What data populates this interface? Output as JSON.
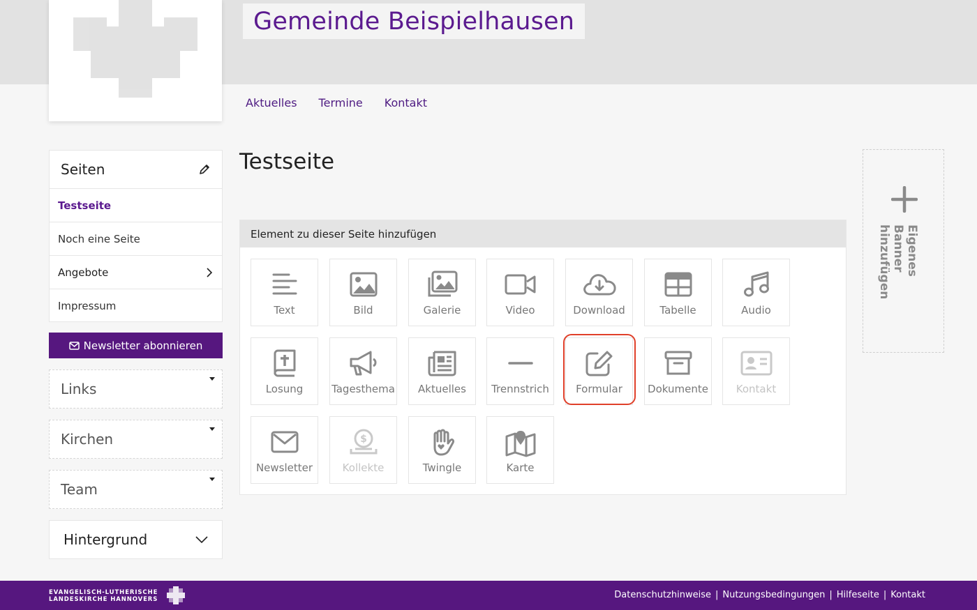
{
  "site": {
    "title": "Gemeinde Beispielhausen"
  },
  "nav": [
    "Aktuelles",
    "Termine",
    "Kontakt"
  ],
  "sidebar": {
    "pages_title": "Seiten",
    "pages": [
      {
        "label": "Testseite",
        "active": true
      },
      {
        "label": "Noch eine Seite"
      },
      {
        "label": "Angebote",
        "has_children": true
      },
      {
        "label": "Impressum"
      }
    ],
    "newsletter_button": "Newsletter abonnieren",
    "widgets": [
      "Links",
      "Kirchen",
      "Team"
    ],
    "background_label": "Hintergrund"
  },
  "main": {
    "page_title": "Testseite",
    "panel_title": "Element zu dieser Seite hinzufügen",
    "elements": [
      {
        "label": "Text",
        "icon": "text-icon"
      },
      {
        "label": "Bild",
        "icon": "image-icon"
      },
      {
        "label": "Galerie",
        "icon": "gallery-icon"
      },
      {
        "label": "Video",
        "icon": "video-icon"
      },
      {
        "label": "Download",
        "icon": "cloud-download-icon"
      },
      {
        "label": "Tabelle",
        "icon": "table-icon"
      },
      {
        "label": "Audio",
        "icon": "music-icon"
      },
      {
        "label": "Losung",
        "icon": "bible-icon"
      },
      {
        "label": "Tagesthema",
        "icon": "megaphone-icon"
      },
      {
        "label": "Aktuelles",
        "icon": "newspaper-icon"
      },
      {
        "label": "Trennstrich",
        "icon": "divider-icon"
      },
      {
        "label": "Formular",
        "icon": "edit-form-icon",
        "highlighted": true
      },
      {
        "label": "Dokumente",
        "icon": "archive-icon"
      },
      {
        "label": "Kontakt",
        "icon": "contact-card-icon",
        "disabled": true
      },
      {
        "label": "Newsletter",
        "icon": "envelope-icon"
      },
      {
        "label": "Kollekte",
        "icon": "donation-icon",
        "disabled": true
      },
      {
        "label": "Twingle",
        "icon": "hand-heart-icon"
      },
      {
        "label": "Karte",
        "icon": "map-icon"
      }
    ]
  },
  "banner": {
    "add_label": "Eigenes Banner hinzufügen"
  },
  "footer": {
    "brand_line1": "EVANGELISCH-LUTHERISCHE",
    "brand_line2": "LANDESKIRCHE HANNOVERS",
    "links": [
      "Datenschutzhinweise",
      "Nutzungsbedingungen",
      "Hilfeseite",
      "Kontakt"
    ]
  },
  "colors": {
    "brand": "#56177f",
    "accent_text": "#5b1a8f",
    "highlight": "#e0402a"
  }
}
